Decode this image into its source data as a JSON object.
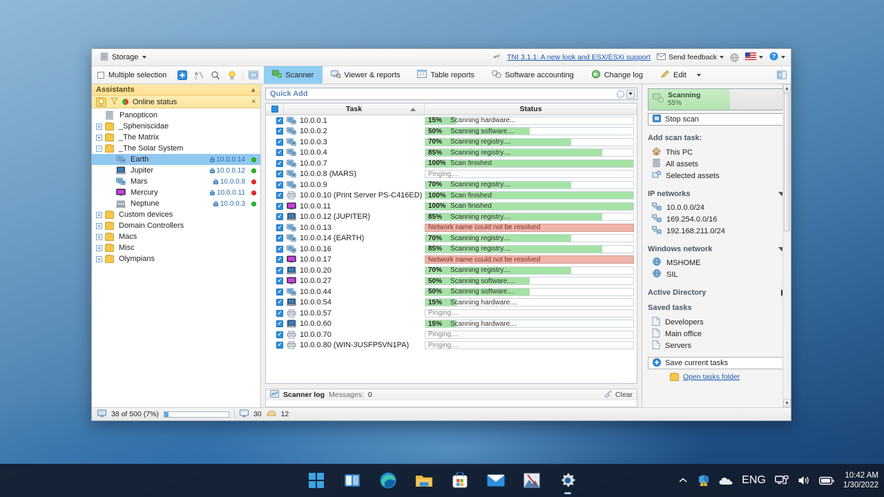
{
  "window": {
    "storage_label": "Storage",
    "news_link": "TNI 3.1.1: A new look and ESX/ESXi support",
    "send_feedback": "Send feedback",
    "lang_label": "EN"
  },
  "toolbar": {
    "multiple_selection": "Multiple selection",
    "icons": [
      "add-icon",
      "sort-icon",
      "search-icon",
      "bulb-icon",
      "window-icon"
    ],
    "tabs": [
      {
        "label": "Scanner",
        "icon": "scanner-icon",
        "active": true
      },
      {
        "label": "Viewer & reports",
        "icon": "viewer-icon",
        "active": false
      },
      {
        "label": "Table reports",
        "icon": "table-icon",
        "active": false
      },
      {
        "label": "Software accounting",
        "icon": "software-icon",
        "active": false
      },
      {
        "label": "Change log",
        "icon": "changelog-icon",
        "active": false
      },
      {
        "label": "Edit",
        "icon": "pencil-icon",
        "active": false
      }
    ]
  },
  "sidebar": {
    "assistants_title": "Assistants",
    "online_status": "Online status",
    "tree": [
      {
        "label": "Panopticon",
        "depth": 0,
        "icon": "storage-icon",
        "expander": "none",
        "ip": "",
        "status": ""
      },
      {
        "label": "_Spheniscidae",
        "depth": 0,
        "icon": "folder",
        "expander": "plus",
        "ip": "",
        "status": ""
      },
      {
        "label": "_The Matrix",
        "depth": 0,
        "icon": "folder",
        "expander": "plus",
        "ip": "",
        "status": ""
      },
      {
        "label": "_The Solar System",
        "depth": 0,
        "icon": "folder",
        "expander": "minus",
        "ip": "",
        "status": ""
      },
      {
        "label": "Earth",
        "depth": 1,
        "icon": "pc-icon",
        "expander": "none",
        "ip": "10.0.0.14",
        "status": "green",
        "selected": true
      },
      {
        "label": "Jupiter",
        "depth": 1,
        "icon": "laptop-icon",
        "expander": "none",
        "ip": "10.0.0.12",
        "status": "green"
      },
      {
        "label": "Mars",
        "depth": 1,
        "icon": "pc-icon",
        "expander": "none",
        "ip": "10.0.0.8",
        "status": "red"
      },
      {
        "label": "Mercury",
        "depth": 1,
        "icon": "monitor-icon",
        "expander": "none",
        "ip": "10.0.0.11",
        "status": "red"
      },
      {
        "label": "Neptune",
        "depth": 1,
        "icon": "server-icon",
        "expander": "none",
        "ip": "10.0.0.3",
        "status": "green"
      },
      {
        "label": "Custom devices",
        "depth": 0,
        "icon": "folder",
        "expander": "plus",
        "ip": "",
        "status": ""
      },
      {
        "label": "Domain Controllers",
        "depth": 0,
        "icon": "folder",
        "expander": "plus",
        "ip": "",
        "status": ""
      },
      {
        "label": "Macs",
        "depth": 0,
        "icon": "folder",
        "expander": "plus",
        "ip": "",
        "status": ""
      },
      {
        "label": "Misc",
        "depth": 0,
        "icon": "folder",
        "expander": "plus",
        "ip": "",
        "status": ""
      },
      {
        "label": "Olympians",
        "depth": 0,
        "icon": "folder",
        "expander": "plus",
        "ip": "",
        "status": ""
      }
    ]
  },
  "center": {
    "quick_add_placeholder": "Quick Add",
    "col_task": "Task",
    "col_status": "Status",
    "rows": [
      {
        "task": "10.0.0.1",
        "icon": "pc-icon",
        "pct": "15%",
        "pct_value": 15,
        "text": "Scanning hardware...",
        "state": "progress"
      },
      {
        "task": "10.0.0.2",
        "icon": "pc-icon",
        "pct": "50%",
        "pct_value": 50,
        "text": "Scanning software....",
        "state": "progress"
      },
      {
        "task": "10.0.0.3",
        "icon": "pc-icon",
        "pct": "70%",
        "pct_value": 70,
        "text": "Scanning registry....",
        "state": "progress"
      },
      {
        "task": "10.0.0.4",
        "icon": "pc-icon",
        "pct": "85%",
        "pct_value": 85,
        "text": "Scanning registry....",
        "state": "progress"
      },
      {
        "task": "10.0.0.7",
        "icon": "pc-icon",
        "pct": "100%",
        "pct_value": 100,
        "text": "Scan finished",
        "state": "progress"
      },
      {
        "task": "10.0.0.8 (MARS)",
        "icon": "pc-icon",
        "pct": "",
        "pct_value": 0,
        "text": "Pinging....",
        "state": "pending"
      },
      {
        "task": "10.0.0.9",
        "icon": "pc-icon",
        "pct": "70%",
        "pct_value": 70,
        "text": "Scanning registry....",
        "state": "progress"
      },
      {
        "task": "10.0.0.10 (Print Server PS-C416ED)",
        "icon": "printer-icon",
        "pct": "100%",
        "pct_value": 100,
        "text": "Scan finished",
        "state": "progress"
      },
      {
        "task": "10.0.0.11",
        "icon": "monitor-icon",
        "pct": "100%",
        "pct_value": 100,
        "text": "Scan finished",
        "state": "progress"
      },
      {
        "task": "10.0.0.12 (JUPITER)",
        "icon": "laptop-icon",
        "pct": "85%",
        "pct_value": 85,
        "text": "Scanning registry....",
        "state": "progress"
      },
      {
        "task": "10.0.0.13",
        "icon": "pc-icon",
        "pct": "",
        "pct_value": 0,
        "text": "Network name could not be resolved",
        "state": "error"
      },
      {
        "task": "10.0.0.14 (EARTH)",
        "icon": "pc-icon",
        "pct": "70%",
        "pct_value": 70,
        "text": "Scanning registry....",
        "state": "progress"
      },
      {
        "task": "10.0.0.16",
        "icon": "pc-icon",
        "pct": "85%",
        "pct_value": 85,
        "text": "Scanning registry....",
        "state": "progress"
      },
      {
        "task": "10.0.0.17",
        "icon": "monitor-icon",
        "pct": "",
        "pct_value": 0,
        "text": "Network name could not be resolved",
        "state": "error"
      },
      {
        "task": "10.0.0.20",
        "icon": "laptop-icon",
        "pct": "70%",
        "pct_value": 70,
        "text": "Scanning registry....",
        "state": "progress"
      },
      {
        "task": "10.0.0.27",
        "icon": "monitor-icon",
        "pct": "50%",
        "pct_value": 50,
        "text": "Scanning software....",
        "state": "progress"
      },
      {
        "task": "10.0.0.44",
        "icon": "pc-icon",
        "pct": "50%",
        "pct_value": 50,
        "text": "Scanning software....",
        "state": "progress"
      },
      {
        "task": "10.0.0.54",
        "icon": "laptop-icon",
        "pct": "15%",
        "pct_value": 15,
        "text": "Scanning hardware....",
        "state": "progress"
      },
      {
        "task": "10.0.0.57",
        "icon": "printer-icon",
        "pct": "",
        "pct_value": 0,
        "text": "Pinging....",
        "state": "pending"
      },
      {
        "task": "10.0.0.60",
        "icon": "laptop-icon",
        "pct": "15%",
        "pct_value": 15,
        "text": "Scanning hardware....",
        "state": "progress"
      },
      {
        "task": "10.0.0.70",
        "icon": "printer-icon",
        "pct": "",
        "pct_value": 0,
        "text": "Pinging....",
        "state": "pending"
      },
      {
        "task": "10.0.0.80 (WIN-3USFP5VN1PA)",
        "icon": "printer-icon",
        "pct": "",
        "pct_value": 0,
        "text": "Pinging....",
        "state": "pending"
      }
    ],
    "log_title": "Scanner log",
    "log_messages_label": "Messages:",
    "log_messages_count": "0",
    "clear_label": "Clear"
  },
  "right": {
    "scanning_title": "Scanning",
    "scanning_pct": "55%",
    "stop_scan": "Stop scan",
    "add_scan_task_label": "Add scan task:",
    "scan_targets": [
      {
        "label": "This PC",
        "icon": "home-icon"
      },
      {
        "label": "All assets",
        "icon": "storage-icon"
      },
      {
        "label": "Selected assets",
        "icon": "selected-icon"
      }
    ],
    "ip_networks_label": "IP networks",
    "ip_networks": [
      "10.0.0.0/24",
      "169.254.0.0/16",
      "192.168.211.0/24"
    ],
    "windows_network_label": "Windows network",
    "windows_networks": [
      "MSHOME",
      "SIL"
    ],
    "active_directory_label": "Active Directory",
    "saved_tasks_label": "Saved tasks",
    "saved_tasks": [
      "Developers",
      "Main office",
      "Servers"
    ],
    "save_current_tasks": "Save current tasks",
    "open_tasks_folder": "Open tasks folder"
  },
  "statusbar": {
    "assets_text": "38 of 500 (7%)",
    "progress_pct": 7,
    "online_count": "30",
    "other_count": "12"
  },
  "taskbar": {
    "items": [
      {
        "name": "start-button",
        "icon": "windows-logo-icon"
      },
      {
        "name": "task-view-button",
        "icon": "task-view-icon"
      },
      {
        "name": "edge-button",
        "icon": "edge-icon"
      },
      {
        "name": "file-explorer-button",
        "icon": "folder-icon"
      },
      {
        "name": "store-button",
        "icon": "store-icon"
      },
      {
        "name": "mail-button",
        "icon": "mail-icon"
      },
      {
        "name": "photos-button",
        "icon": "photos-icon"
      },
      {
        "name": "settings-button",
        "icon": "gear-icon",
        "active": true
      }
    ],
    "tray": {
      "language": "ENG",
      "time": "10:42 AM",
      "date": "1/30/2022"
    }
  }
}
